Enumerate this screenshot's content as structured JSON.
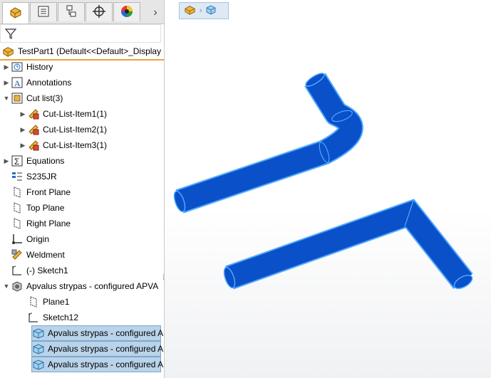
{
  "colors": {
    "accent": "#e8a33c",
    "selection": "#b9d3ea",
    "tube": "#0a50c8",
    "tube_edge": "#4ea8ff"
  },
  "tabs": [
    {
      "icon": "feature-manager-icon"
    },
    {
      "icon": "property-manager-icon"
    },
    {
      "icon": "configuration-manager-icon"
    },
    {
      "icon": "dimxpert-manager-icon"
    },
    {
      "icon": "display-manager-icon"
    }
  ],
  "tab_more_arrow": "›",
  "root": {
    "label": "TestPart1  (Default<<Default>_Display"
  },
  "tree": [
    {
      "label": "History",
      "icon": "history-icon",
      "expander": "▶",
      "indent": 0
    },
    {
      "label": "Annotations",
      "icon": "annotations-icon",
      "expander": "▶",
      "indent": 0
    },
    {
      "label": "Cut list(3)",
      "icon": "cut-list-icon",
      "expander": "▼",
      "indent": 0
    },
    {
      "label": "Cut-List-Item1(1)",
      "icon": "cut-list-item-icon",
      "expander": "▶",
      "indent": 1
    },
    {
      "label": "Cut-List-Item2(1)",
      "icon": "cut-list-item-icon",
      "expander": "▶",
      "indent": 1
    },
    {
      "label": "Cut-List-Item3(1)",
      "icon": "cut-list-item-icon",
      "expander": "▶",
      "indent": 1
    },
    {
      "label": "Equations",
      "icon": "equations-icon",
      "expander": "▶",
      "indent": 0
    },
    {
      "label": "S235JR",
      "icon": "material-icon",
      "expander": "",
      "indent": 0
    },
    {
      "label": "Front Plane",
      "icon": "plane-icon",
      "expander": "",
      "indent": 0
    },
    {
      "label": "Top Plane",
      "icon": "plane-icon",
      "expander": "",
      "indent": 0
    },
    {
      "label": "Right Plane",
      "icon": "plane-icon",
      "expander": "",
      "indent": 0
    },
    {
      "label": "Origin",
      "icon": "origin-icon",
      "expander": "",
      "indent": 0
    },
    {
      "label": "Weldment",
      "icon": "weldment-icon",
      "expander": "",
      "indent": 0
    },
    {
      "label": "(-) Sketch1",
      "icon": "sketch-icon",
      "expander": "",
      "indent": 0
    },
    {
      "label": "Apvalus strypas - configured APVA",
      "icon": "structural-member-icon",
      "expander": "▼",
      "indent": 0
    },
    {
      "label": "Plane1",
      "icon": "plane-icon",
      "expander": "",
      "indent": 1
    },
    {
      "label": "Sketch12",
      "icon": "sketch-icon",
      "expander": "",
      "indent": 1
    },
    {
      "label": "Apvalus strypas - configured A",
      "icon": "solid-body-icon",
      "expander": "",
      "indent": 1,
      "selected": true
    },
    {
      "label": "Apvalus strypas - configured A",
      "icon": "solid-body-icon",
      "expander": "",
      "indent": 1,
      "selected": true
    },
    {
      "label": "Apvalus strypas - configured A",
      "icon": "solid-body-icon",
      "expander": "",
      "indent": 1,
      "selected": true
    }
  ],
  "breadcrumb": {
    "items": [
      "part-icon",
      "body-icon"
    ]
  }
}
